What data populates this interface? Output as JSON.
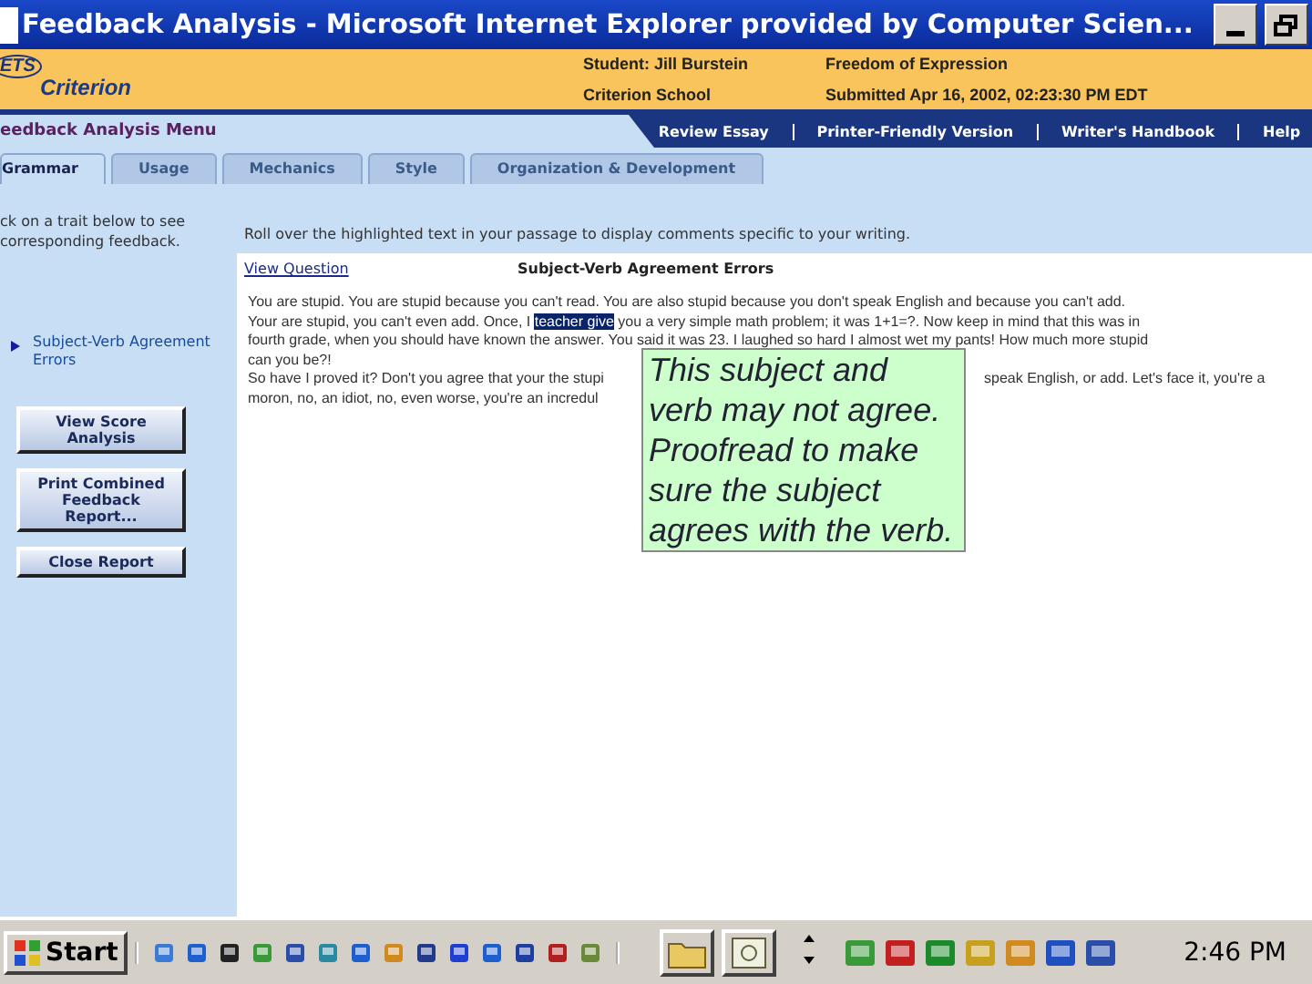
{
  "window": {
    "title": "Feedback Analysis - Microsoft Internet Explorer provided by Computer Scien..."
  },
  "header": {
    "logo_mark": "ETS",
    "logo": "Criterion",
    "student": "Student: Jill Burstein",
    "school": "Criterion School",
    "essay_title": "Freedom of Expression",
    "submitted": "Submitted Apr 16, 2002, 02:23:30 PM EDT"
  },
  "menu_title": "eedback Analysis Menu",
  "nav_links": [
    "Review Essay",
    "Printer-Friendly Version",
    "Writer's Handbook",
    "Help"
  ],
  "tabs": [
    {
      "label": "Grammar",
      "selected": true
    },
    {
      "label": "Usage",
      "selected": false
    },
    {
      "label": "Mechanics",
      "selected": false
    },
    {
      "label": "Style",
      "selected": false
    },
    {
      "label": "Organization & Development",
      "selected": false
    }
  ],
  "sidebar": {
    "instruction": "ck on a trait below to see corresponding feedback.",
    "items": [
      {
        "label": "Subject-Verb Agreement Errors",
        "selected": true
      }
    ],
    "buttons": [
      "View Score Analysis",
      "Print Combined Feedback Report...",
      "Close Report"
    ]
  },
  "main": {
    "instruction": "Roll over the highlighted text in your passage to display comments specific to your writing.",
    "view_question": "View Question",
    "heading": "Subject-Verb Agreement Errors",
    "lines": [
      {
        "segments": [
          {
            "text": "You are stupid. You are stupid because you can't read. You are also stupid because you don't speak English and because you can't add.",
            "kind": "plain"
          }
        ]
      },
      {
        "segments": [
          {
            "text": "Your are stupid, you can't even add. Once, I ",
            "kind": "plain"
          },
          {
            "text": "teacher give",
            "kind": "highlight"
          },
          {
            "text": " you a very simple math problem; it was 1+1=?. Now keep in mind that this was in",
            "kind": "plain"
          }
        ]
      },
      {
        "segments": [
          {
            "text": "fourth grade, when you should have known the answer. You said it was 23. I laughed so hard I almost wet my pants! How much more stupid",
            "kind": "plain"
          }
        ]
      },
      {
        "segments": [
          {
            "text": "can you be?!",
            "kind": "plain"
          }
        ]
      },
      {
        "segments": [
          {
            "text": "So have I proved it? Don't you agree that your the stupi",
            "kind": "plain"
          }
        ],
        "right": "speak English, or add. Let's face it, you're a"
      },
      {
        "segments": [
          {
            "text": "moron, no, an idiot, no, even worse, you're an incredul",
            "kind": "plain"
          }
        ]
      }
    ],
    "tooltip": "This subject and verb may not agree. Proofread to make sure the subject agrees with the verb."
  },
  "taskbar": {
    "start": "Start",
    "time": "2:46 PM"
  }
}
